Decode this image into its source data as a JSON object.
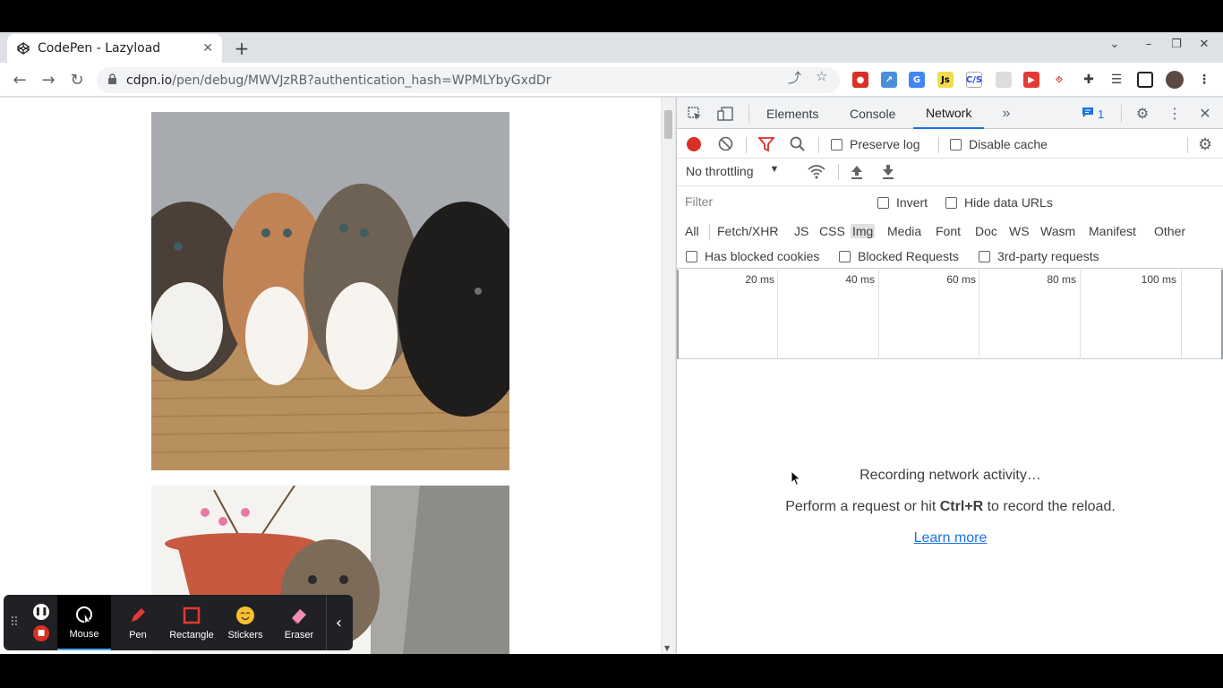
{
  "browser": {
    "tab_title": "CodePen - Lazyload",
    "url_host": "cdpn.io",
    "url_path": "/pen/debug/MWVJzRB?authentication_hash=WPMLYbyGxdDr"
  },
  "page": {
    "images": [
      {
        "alt": "kittens-in-basket"
      },
      {
        "alt": "kitten-with-flowerpot"
      }
    ]
  },
  "recorder": {
    "tools": [
      {
        "label": "Mouse",
        "icon": "cursor-circle-icon",
        "active": true
      },
      {
        "label": "Pen",
        "icon": "pen-icon"
      },
      {
        "label": "Rectangle",
        "icon": "rectangle-icon"
      },
      {
        "label": "Stickers",
        "icon": "sticker-icon"
      },
      {
        "label": "Eraser",
        "icon": "eraser-icon"
      }
    ]
  },
  "devtools": {
    "tabs": [
      "Elements",
      "Console",
      "Network"
    ],
    "active_tab": "Network",
    "issues_count": "1",
    "preserve_log": "Preserve log",
    "disable_cache": "Disable cache",
    "throttling": "No throttling",
    "filter_placeholder": "Filter",
    "invert": "Invert",
    "hide_data_urls": "Hide data URLs",
    "types": [
      "All",
      "Fetch/XHR",
      "JS",
      "CSS",
      "Img",
      "Media",
      "Font",
      "Doc",
      "WS",
      "Wasm",
      "Manifest",
      "Other"
    ],
    "selected_type": "Img",
    "has_blocked_cookies": "Has blocked cookies",
    "blocked_requests": "Blocked Requests",
    "third_party": "3rd-party requests",
    "timeline_ticks": [
      "20 ms",
      "40 ms",
      "60 ms",
      "80 ms",
      "100 ms"
    ],
    "recording_msg": "Recording network activity…",
    "perform_prefix": "Perform a request or hit ",
    "perform_key": "Ctrl+R",
    "perform_suffix": " to record the reload.",
    "learn_more": "Learn more"
  },
  "colors": {
    "accent": "#1a73e8",
    "record_red": "#d93025"
  }
}
